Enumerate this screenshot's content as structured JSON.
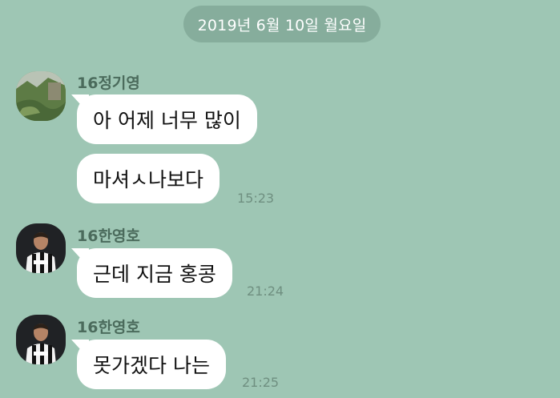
{
  "date_divider": "2019년 6월 10일 월요일",
  "messages": [
    {
      "sender": "16정기영",
      "avatar": "landscape-avatar",
      "bubbles": [
        "아 어제 너무 많이",
        "마셔ㅅ나보다"
      ],
      "time": "15:23"
    },
    {
      "sender": "16한영호",
      "avatar": "soccer-player-avatar",
      "bubbles": [
        "근데 지금 홍콩"
      ],
      "time": "21:24"
    },
    {
      "sender": "16한영호",
      "avatar": "soccer-player-avatar",
      "bubbles": [
        "못가겠다 나는"
      ],
      "time": "21:25"
    }
  ],
  "colors": {
    "background": "#9ec6b4",
    "date_pill": "#86ad9c",
    "bubble": "#ffffff",
    "sender_text": "#4b6b5c",
    "time_text": "#6f8f80"
  }
}
